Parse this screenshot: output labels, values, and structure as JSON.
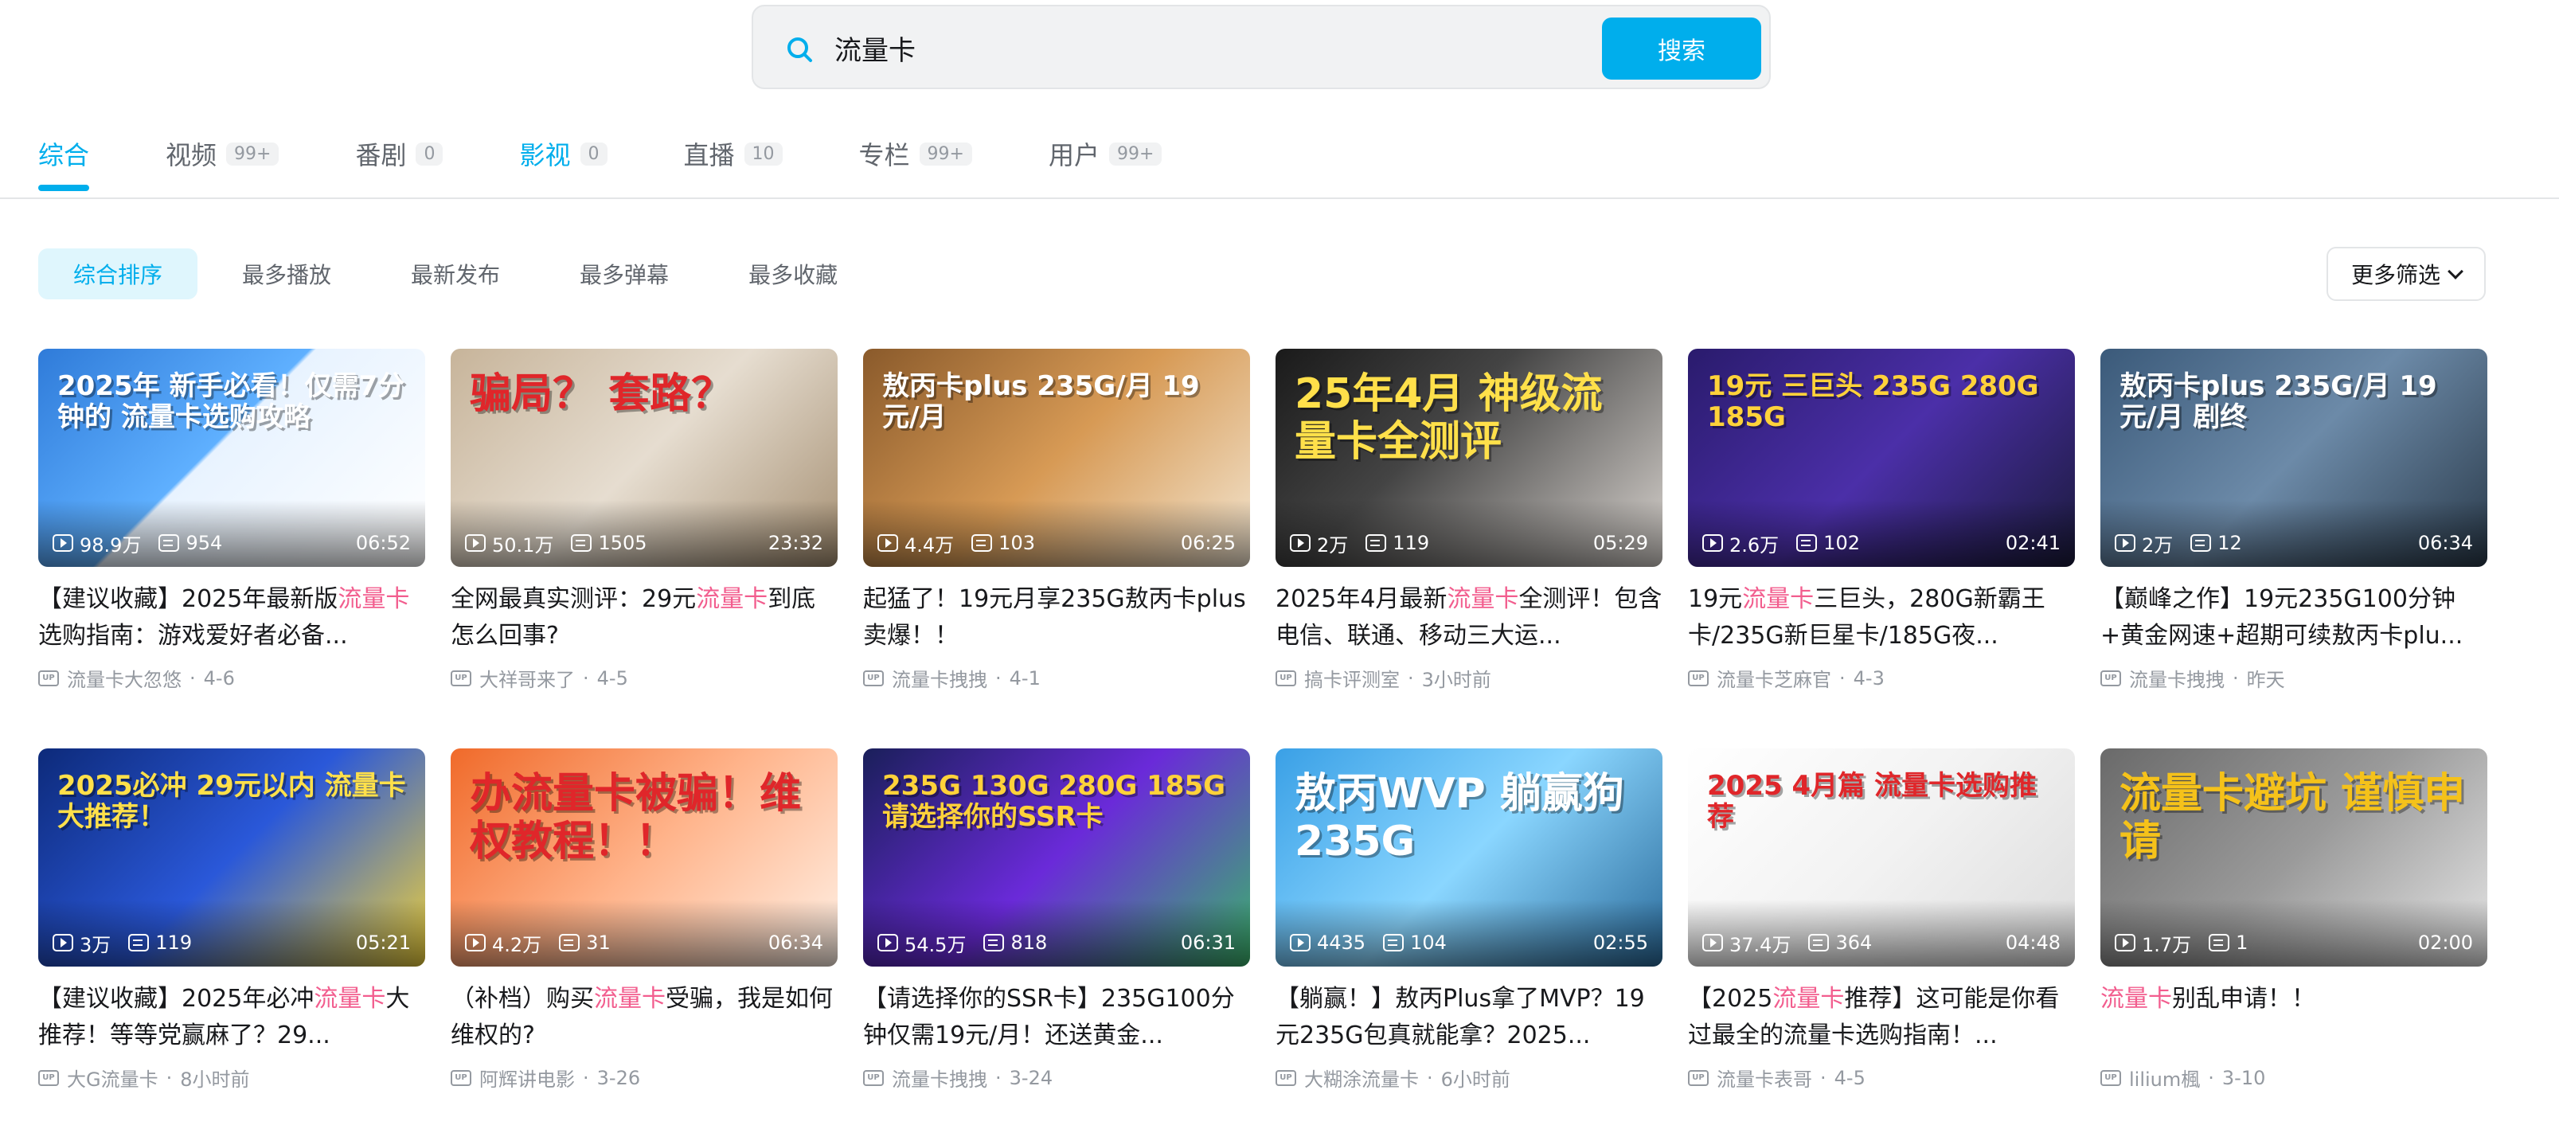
{
  "search": {
    "value": "流量卡",
    "button_label": "搜索"
  },
  "tabs": [
    {
      "label": "综合",
      "count": ""
    },
    {
      "label": "视频",
      "count": "99+"
    },
    {
      "label": "番剧",
      "count": "0"
    },
    {
      "label": "影视",
      "count": "0"
    },
    {
      "label": "直播",
      "count": "10"
    },
    {
      "label": "专栏",
      "count": "99+"
    },
    {
      "label": "用户",
      "count": "99+"
    }
  ],
  "sort": [
    "综合排序",
    "最多播放",
    "最新发布",
    "最多弹幕",
    "最多收藏"
  ],
  "more_filter": "更多筛选",
  "colors": {
    "accent": "#00aeec",
    "highlight": "#f25d8e"
  },
  "videos": [
    {
      "plays": "98.9万",
      "danmaku": "954",
      "duration": "06:52",
      "title_pre": "【建议收藏】2025年最新版",
      "title_hl": "流量卡",
      "title_post": "选购指南：游戏爱好者必备...",
      "author": "流量卡大忽悠",
      "date": "4-6",
      "thumb_text": "2025年 新手必看！仅需7分钟的 流量卡选购攻略"
    },
    {
      "plays": "50.1万",
      "danmaku": "1505",
      "duration": "23:32",
      "title_pre": "全网最真实测评：29元",
      "title_hl": "流量卡",
      "title_post": "到底怎么回事?",
      "author": "大祥哥来了",
      "date": "4-5",
      "thumb_text": "骗局？ 套路？"
    },
    {
      "plays": "4.4万",
      "danmaku": "103",
      "duration": "06:25",
      "title_pre": "起猛了！19元月享235G敖丙卡plus卖爆！！",
      "title_hl": "",
      "title_post": "",
      "author": "流量卡拽拽",
      "date": "4-1",
      "thumb_text": "敖丙卡plus 235G/月 19元/月"
    },
    {
      "plays": "2万",
      "danmaku": "119",
      "duration": "05:29",
      "title_pre": "2025年4月最新",
      "title_hl": "流量卡",
      "title_post": "全测评！包含电信、联通、移动三大运...",
      "author": "搞卡评测室",
      "date": "3小时前",
      "thumb_text": "25年4月 神级流量卡全测评"
    },
    {
      "plays": "2.6万",
      "danmaku": "102",
      "duration": "02:41",
      "title_pre": "19元",
      "title_hl": "流量卡",
      "title_post": "三巨头，280G新霸王卡/235G新巨星卡/185G夜...",
      "author": "流量卡芝麻官",
      "date": "4-3",
      "thumb_text": "19元 三巨头 235G 280G 185G"
    },
    {
      "plays": "2万",
      "danmaku": "12",
      "duration": "06:34",
      "title_pre": "【巅峰之作】19元235G100分钟+黄金网速+超期可续敖丙卡plu...",
      "title_hl": "",
      "title_post": "",
      "author": "流量卡拽拽",
      "date": "昨天",
      "thumb_text": "敖丙卡plus 235G/月 19元/月 剧终"
    },
    {
      "plays": "3万",
      "danmaku": "119",
      "duration": "05:21",
      "title_pre": "【建议收藏】2025年必冲",
      "title_hl": "流量卡",
      "title_post": "大推荐！等等党赢麻了？29...",
      "author": "大G流量卡",
      "date": "8小时前",
      "thumb_text": "2025必冲 29元以内 流量卡大推荐！"
    },
    {
      "plays": "4.2万",
      "danmaku": "31",
      "duration": "06:34",
      "title_pre": "（补档）购买",
      "title_hl": "流量卡",
      "title_post": "受骗，我是如何维权的?",
      "author": "阿辉讲电影",
      "date": "3-26",
      "thumb_text": "办流量卡被骗！维权教程！！"
    },
    {
      "plays": "54.5万",
      "danmaku": "818",
      "duration": "06:31",
      "title_pre": "【请选择你的SSR卡】235G100分钟仅需19元/月！还送黄金...",
      "title_hl": "",
      "title_post": "",
      "author": "流量卡拽拽",
      "date": "3-24",
      "thumb_text": "235G 130G 280G 185G 请选择你的SSR卡"
    },
    {
      "plays": "4435",
      "danmaku": "104",
      "duration": "02:55",
      "title_pre": "【躺赢！】敖丙Plus拿了MVP？19元235G包真就能拿？2025...",
      "title_hl": "",
      "title_post": "",
      "author": "大糊涂流量卡",
      "date": "6小时前",
      "thumb_text": "敖丙WVP 躺赢狗 235G"
    },
    {
      "plays": "37.4万",
      "danmaku": "364",
      "duration": "04:48",
      "title_pre": "【2025",
      "title_hl": "流量卡",
      "title_post": "推荐】这可能是你看过最全的流量卡选购指南！...",
      "author": "流量卡表哥",
      "date": "4-5",
      "thumb_text": "2025 4月篇 流量卡选购推荐"
    },
    {
      "plays": "1.7万",
      "danmaku": "1",
      "duration": "02:00",
      "title_pre": "",
      "title_hl": "流量卡",
      "title_post": "别乱申请！！",
      "author": "lilium楓",
      "date": "3-10",
      "thumb_text": "流量卡避坑 谨慎申请"
    }
  ]
}
